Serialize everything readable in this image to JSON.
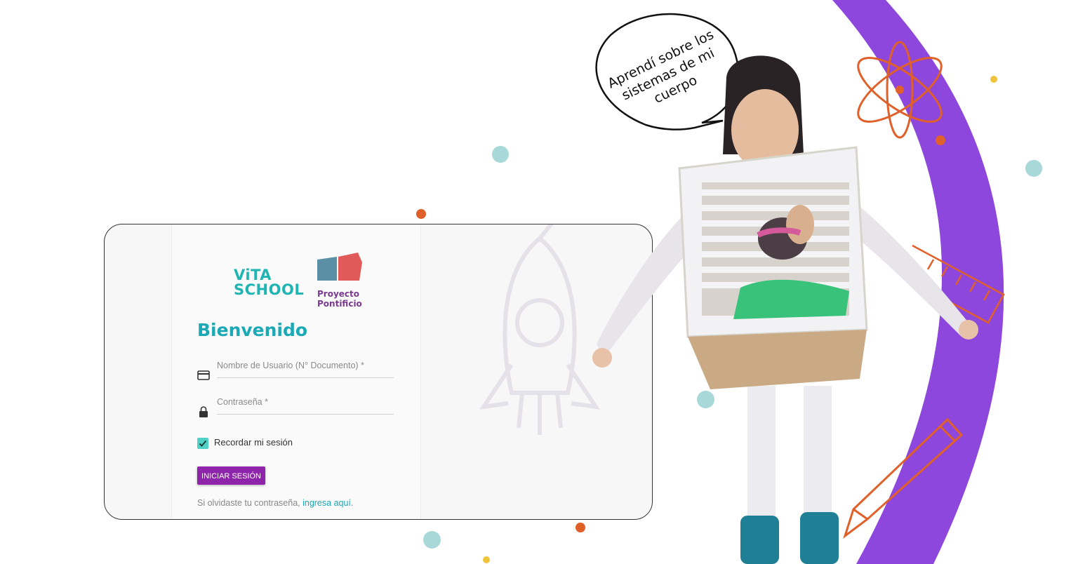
{
  "speech_bubble": {
    "line1": "Aprendí sobre los",
    "line2": "sistemas de mi",
    "line3": "cuerpo"
  },
  "login": {
    "logo_vita_line1": "ViTA",
    "logo_vita_line2": "SCHOOL",
    "logo_pp_line1": "Proyecto",
    "logo_pp_line2": "Pontificio",
    "title": "Bienvenido",
    "username_label": "Nombre de Usuario (N° Documento) *",
    "password_label": "Contraseña *",
    "remember_label": "Recordar mi sesión",
    "submit_label": "INICIAR SESIÓN",
    "forgot_prefix": "Si olvidaste tu contraseña, ",
    "forgot_link": "ingresa aquí",
    "forgot_suffix": "."
  },
  "colors": {
    "accent_teal": "#1ba9b5",
    "button_purple": "#8e24aa",
    "arc_purple": "#8d47dc",
    "doodle_orange": "#e0602a",
    "dot_teal": "#a8d9d8",
    "dot_yellow": "#f0c43c"
  },
  "icons": [
    "credit-card-icon",
    "lock-icon",
    "checkbox-checked-icon",
    "atom-icon",
    "pencil-icon",
    "ruler-icon",
    "rocket-doodle"
  ]
}
